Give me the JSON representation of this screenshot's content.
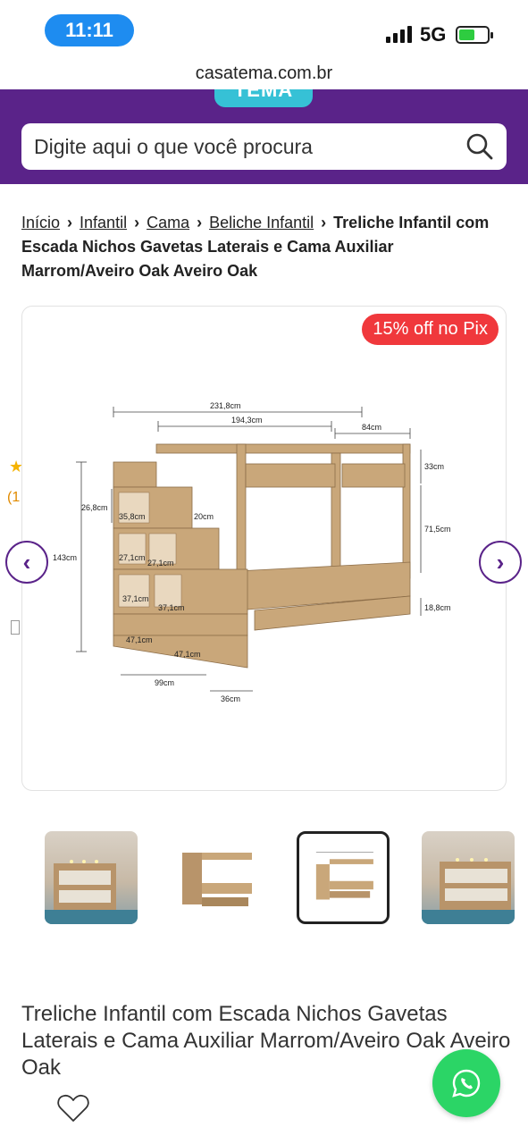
{
  "status": {
    "time": "11:11",
    "network": "5G",
    "battery_level": 0.55
  },
  "browser": {
    "url": "casatema.com.br"
  },
  "header": {
    "logo_text": "TEMA",
    "search_placeholder": "Digite aqui o que você procura"
  },
  "breadcrumb": {
    "items": [
      "Início",
      "Infantil",
      "Cama",
      "Beliche Infantil"
    ],
    "current": "Treliche Infantil com Escada Nichos Gavetas Laterais e Cama Auxiliar Marrom/Aveiro Oak Aveiro Oak"
  },
  "gallery": {
    "badge": "15% off no Pix",
    "dimensions": {
      "total_width": "231,8cm",
      "bed_width": "194,3cm",
      "depth": "84cm",
      "guard_height": "33cm",
      "total_height": "143cm",
      "step_height": "26,8cm",
      "niche_width_top": "35,8cm",
      "niche_height": "20cm",
      "niche_a": "27,1cm",
      "niche_b": "27,1cm",
      "level_height": "71,5cm",
      "drawer_niche_a": "37,1cm",
      "drawer_niche_b": "37,1cm",
      "trundle_height": "18,8cm",
      "drawer_a": "47,1cm",
      "drawer_b": "47,1cm",
      "base_width": "99cm",
      "base_depth": "36cm"
    },
    "thumbnails": [
      "thumbnail-1",
      "thumbnail-2",
      "thumbnail-3",
      "thumbnail-4"
    ],
    "active_thumbnail": 3
  },
  "product": {
    "title": "Treliche Infantil com Escada Nichos Gavetas Laterais e Cama Auxiliar Marrom/Aveiro Oak Aveiro Oak"
  },
  "colors": {
    "brand_purple": "#5a2389",
    "accent_cyan": "#36c1d6",
    "badge_red": "#f0383c",
    "whatsapp_green": "#2bd566",
    "wood": "#b8946a"
  }
}
